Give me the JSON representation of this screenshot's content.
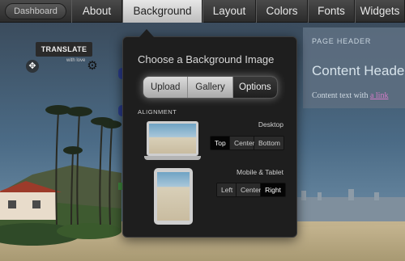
{
  "nav": {
    "dashboard_label": "Dashboard",
    "tabs": [
      {
        "label": "About",
        "active": false
      },
      {
        "label": "Background",
        "active": true
      },
      {
        "label": "Layout",
        "active": false
      },
      {
        "label": "Colors",
        "active": false
      },
      {
        "label": "Fonts",
        "active": false
      },
      {
        "label": "Widgets",
        "active": false
      }
    ]
  },
  "widget": {
    "translate_label": "TRANSLATE",
    "small_text": "with love"
  },
  "header_panel": {
    "label": "PAGE HEADER",
    "title": "Content Header",
    "text_before_link": "Content text with ",
    "link_text": "a link"
  },
  "popover": {
    "title": "Choose a Background Image",
    "segments": [
      {
        "label": "Upload",
        "active": false
      },
      {
        "label": "Gallery",
        "active": false
      },
      {
        "label": "Options",
        "active": true
      }
    ],
    "alignment_label": "ALIGNMENT",
    "desktop": {
      "label": "Desktop",
      "options": [
        {
          "label": "Top",
          "active": true
        },
        {
          "label": "Center",
          "active": false
        },
        {
          "label": "Bottom",
          "active": false
        }
      ]
    },
    "mobile": {
      "label": "Mobile & Tablet",
      "options": [
        {
          "label": "Left",
          "active": false
        },
        {
          "label": "Center",
          "active": false
        },
        {
          "label": "Right",
          "active": true
        }
      ]
    }
  },
  "icons": {
    "move": "move-icon",
    "gear": "gear-icon"
  },
  "colors": {
    "active_tab": "#d6d6d6",
    "link": "#d67bc8",
    "popover_bg": "#1e1e1e"
  }
}
